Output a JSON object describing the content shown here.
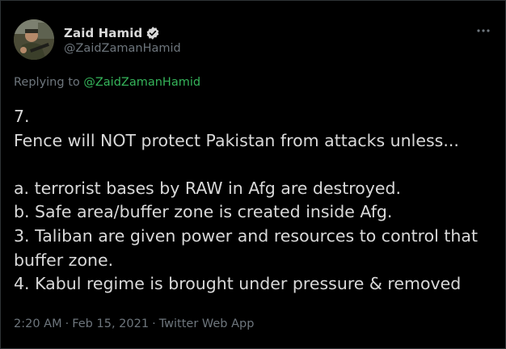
{
  "tweet": {
    "author": {
      "display_name": "Zaid Hamid",
      "handle": "@ZaidZamanHamid",
      "verified": true
    },
    "more_icon": "more-horizontal-icon",
    "replying_prefix": "Replying to ",
    "replying_to": "@ZaidZamanHamid",
    "lines": [
      "7.",
      "Fence will NOT protect Pakistan from attacks unless...",
      "",
      "a. terrorist bases by RAW in Afg are destroyed.",
      "b. Safe area/buffer zone is created inside Afg.",
      "3. Taliban are given power and resources to control that",
      "buffer zone.",
      "4. Kabul regime is brought under pressure & removed"
    ],
    "time": "2:20 AM",
    "separator": "·",
    "date": "Feb 15, 2021",
    "source": "Twitter Web App"
  },
  "colors": {
    "background": "#000000",
    "text": "#d9d9d9",
    "secondary": "#6e767d",
    "mention": "#35b45a",
    "border": "#2f3336"
  }
}
